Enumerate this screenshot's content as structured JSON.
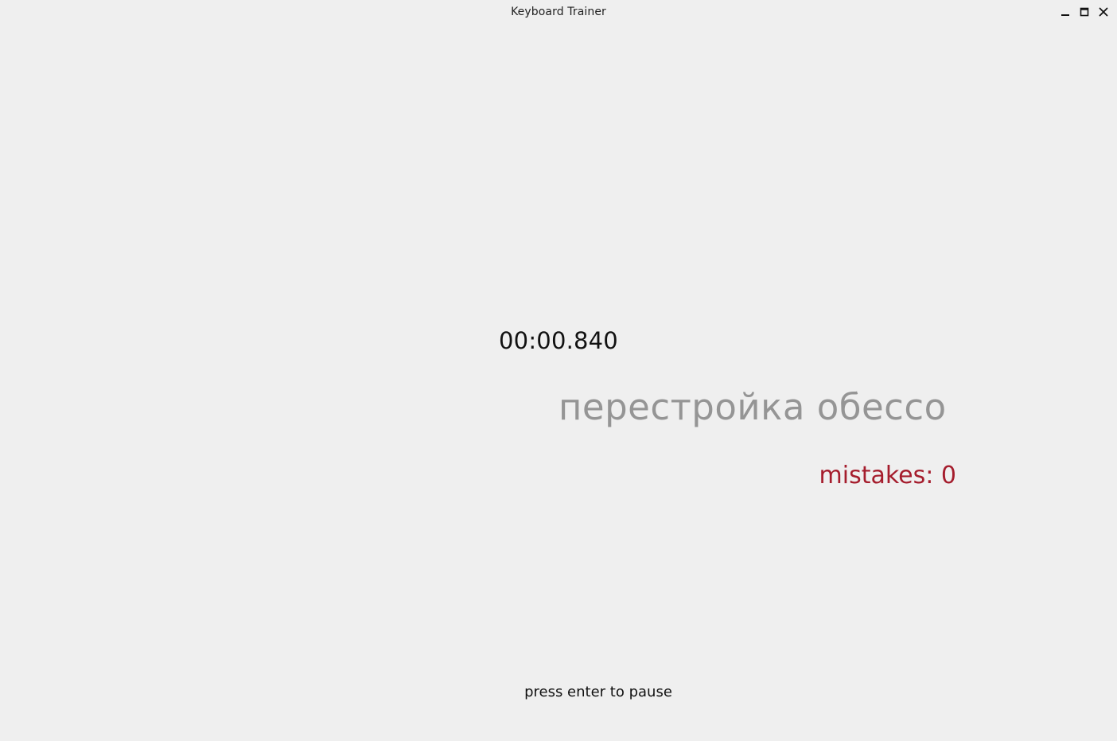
{
  "window": {
    "title": "Keyboard Trainer",
    "controls": {
      "minimize_icon": "minimize-icon",
      "maximize_icon": "maximize-icon",
      "close_icon": "close-icon"
    }
  },
  "trainer": {
    "timer": "00:00.840",
    "target_text": "перестройка обессо",
    "mistakes_label": "mistakes: 0",
    "hint": "press enter to pause"
  },
  "colors": {
    "background": "#efefef",
    "target_text": "#959595",
    "mistakes": "#a51d2d",
    "timer": "#111111"
  }
}
